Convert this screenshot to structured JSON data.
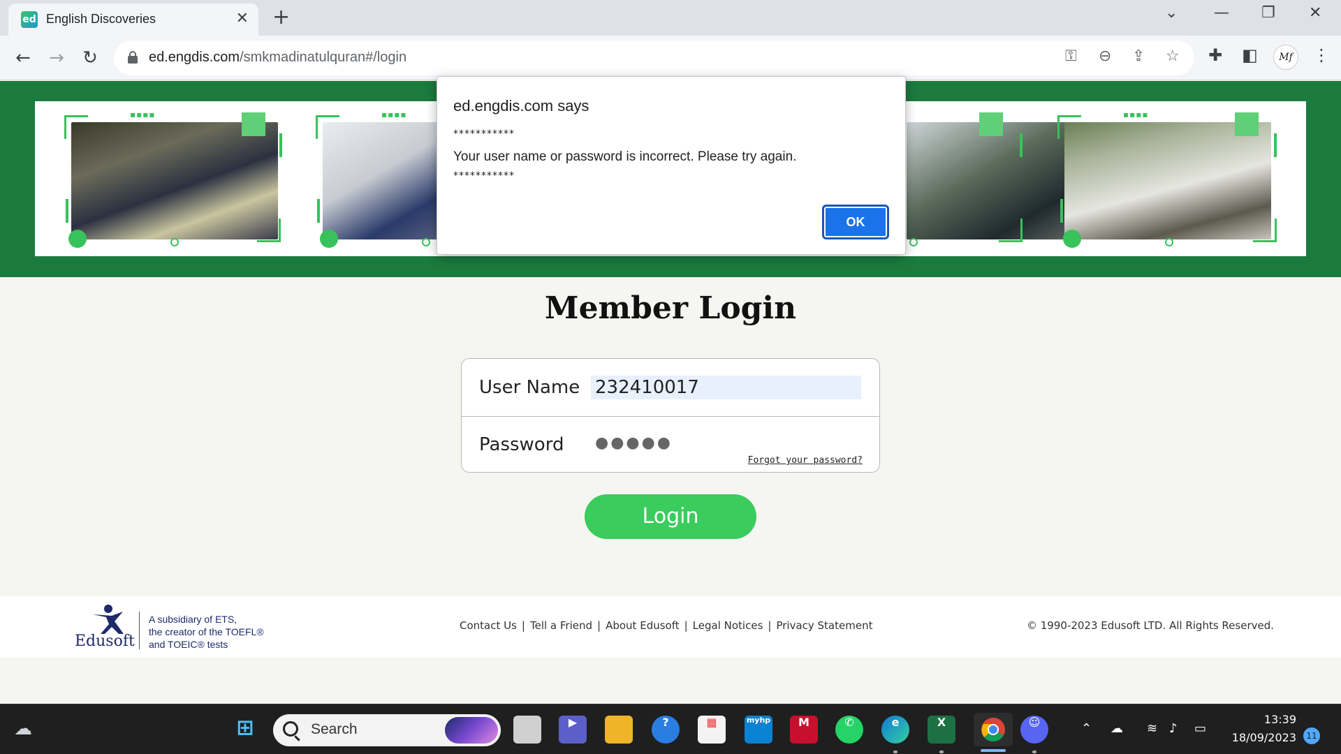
{
  "browser": {
    "tab_title": "English Discoveries",
    "tab_favicon": "ed",
    "url_host": "ed.engdis.com",
    "url_path": "/smkmadinatulquran#/login",
    "profile_initials": "Mf"
  },
  "page": {
    "title": "Member Login",
    "username_label": "User Name",
    "username_value": "232410017",
    "password_label": "Password",
    "password_value": "●●●●●",
    "forgot_link": "Forgot your password?",
    "login_button": "Login",
    "accent_green": "#1b7a3e",
    "button_green": "#3acc5c"
  },
  "footer": {
    "logo_word": "Edusoft",
    "logo_tagline_1": "A subsidiary of ETS,",
    "logo_tagline_2": "the creator of the TOEFL®",
    "logo_tagline_3": "and TOEIC® tests",
    "links": [
      "Contact Us",
      "Tell a Friend",
      "About Edusoft",
      "Legal Notices",
      "Privacy Statement"
    ],
    "copyright": "© 1990-2023 Edusoft LTD. All Rights Reserved."
  },
  "dialog": {
    "title": "ed.engdis.com says",
    "stars_top": "***********",
    "message": "Your user name or password is incorrect. Please try again.",
    "stars_bottom": "***********",
    "ok_button": "OK"
  },
  "taskbar": {
    "search_placeholder": "Search",
    "time": "13:39",
    "date": "18/09/2023",
    "notification_count": "11"
  }
}
